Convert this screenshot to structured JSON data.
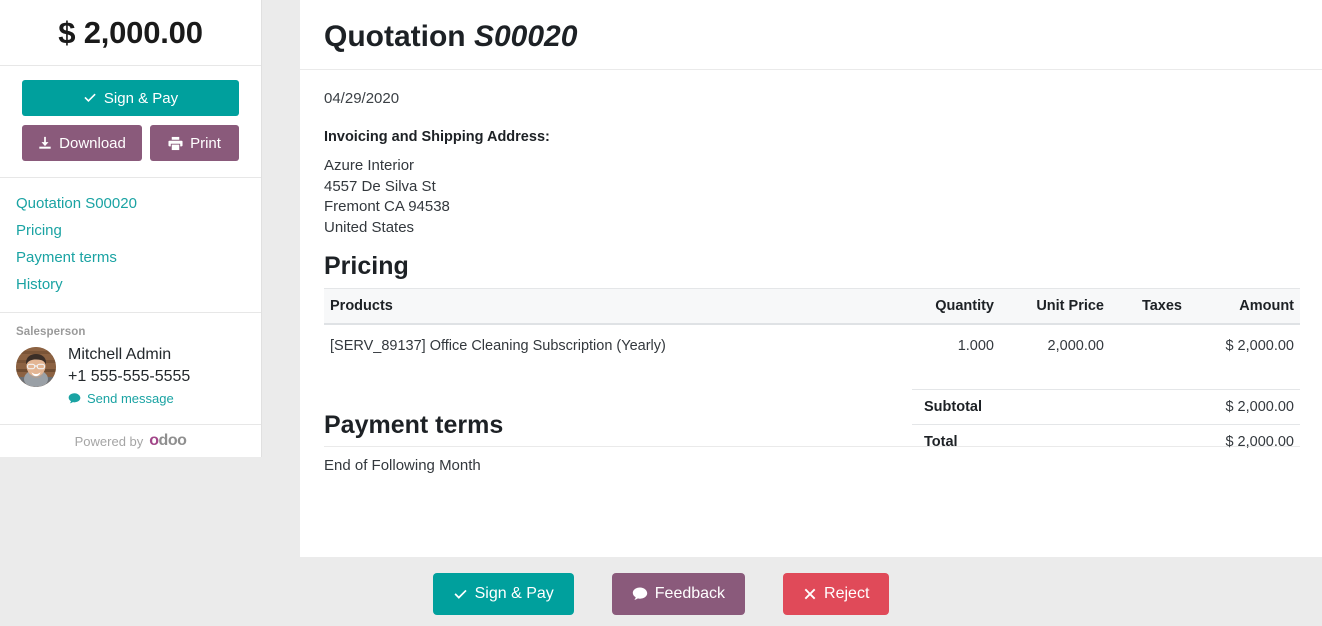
{
  "sidebar": {
    "amount": "$ 2,000.00",
    "actions": {
      "sign_and_pay": "Sign & Pay",
      "download": "Download",
      "print": "Print"
    },
    "nav": [
      {
        "label": "Quotation S00020"
      },
      {
        "label": "Pricing"
      },
      {
        "label": "Payment terms"
      },
      {
        "label": "History"
      }
    ],
    "salesperson": {
      "section_label": "Salesperson",
      "name": "Mitchell Admin",
      "phone": "+1 555-555-5555",
      "send_message": "Send message"
    },
    "footer": {
      "powered_by": "Powered by",
      "brand_first": "o",
      "brand_rest": "doo"
    }
  },
  "document": {
    "title_prefix": "Quotation",
    "reference": "S00020",
    "date": "04/29/2020",
    "address_heading": "Invoicing and Shipping Address:",
    "address_lines": [
      "Azure Interior",
      "4557 De Silva St",
      "Fremont CA 94538",
      "United States"
    ],
    "pricing": {
      "heading": "Pricing",
      "columns": {
        "products": "Products",
        "quantity": "Quantity",
        "unit_price": "Unit Price",
        "taxes": "Taxes",
        "amount": "Amount"
      },
      "rows": [
        {
          "product": "[SERV_89137] Office Cleaning Subscription (Yearly)",
          "quantity": "1.000",
          "unit_price": "2,000.00",
          "taxes": "",
          "amount": "$ 2,000.00"
        }
      ],
      "totals": [
        {
          "label": "Subtotal",
          "value": "$ 2,000.00"
        },
        {
          "label": "Total",
          "value": "$ 2,000.00"
        }
      ]
    },
    "payment_terms": {
      "heading": "Payment terms",
      "text": "End of Following Month"
    }
  },
  "footer_actions": {
    "sign_and_pay": "Sign & Pay",
    "feedback": "Feedback",
    "reject": "Reject"
  },
  "colors": {
    "teal": "#00a09d",
    "purple": "#8a5a7b",
    "red": "#e04a59",
    "link": "#1aa3a3",
    "page_background": "#ebebeb",
    "odoo_accent": "#a24689"
  }
}
